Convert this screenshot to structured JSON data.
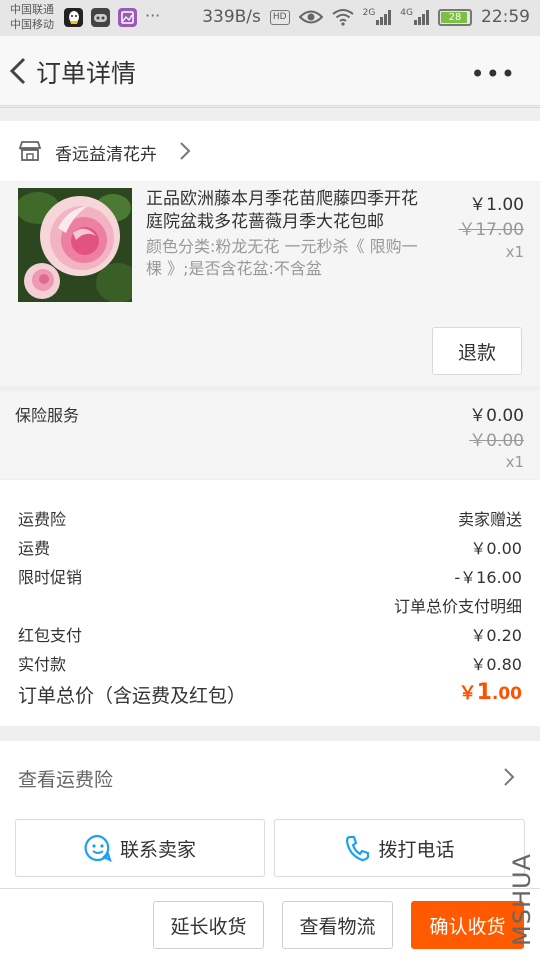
{
  "status_bar": {
    "carrier_1": "中国联通",
    "carrier_2": "中国移动",
    "more": "···",
    "speed": "339B/s",
    "hd": "HD",
    "net_1": "2G",
    "net_2": "4G",
    "battery": "28",
    "time": "22:59"
  },
  "nav": {
    "title": "订单详情",
    "more": "•••"
  },
  "shop": {
    "name": "香远益清花卉"
  },
  "product": {
    "title": "正品欧洲藤本月季花苗爬藤四季开花庭院盆栽多花蔷薇月季大花包邮",
    "sku": "颜色分类:粉龙无花 一元秒杀《 限购一棵 》;是否含花盆:不含盆",
    "price": "￥1.00",
    "original_price": "￥17.00",
    "quantity": "x1",
    "refund_label": "退款"
  },
  "insurance": {
    "label": "保险服务",
    "price": "￥0.00",
    "original_price": "￥0.00",
    "quantity": "x1"
  },
  "summary": {
    "rows": [
      {
        "label": "运费险",
        "value": "卖家赠送"
      },
      {
        "label": "运费",
        "value": "￥0.00"
      },
      {
        "label": "限时促销",
        "value": "-￥16.00"
      },
      {
        "label": "",
        "value": "订单总价支付明细"
      },
      {
        "label": "红包支付",
        "value": "￥0.20"
      },
      {
        "label": "实付款",
        "value": "￥0.80"
      }
    ],
    "total_label": "订单总价（含运费及红包）",
    "total_currency": "￥",
    "total_int": "1",
    "total_dec": ".00"
  },
  "view_insurance": {
    "label": "查看运费险"
  },
  "contact": {
    "seller_label": "联系卖家",
    "phone_label": "拨打电话"
  },
  "bottom": {
    "extend_label": "延长收货",
    "logistics_label": "查看物流",
    "confirm_label": "确认收货"
  },
  "watermark": "MSHUA",
  "colors": {
    "accent": "#ff5000",
    "confirm_bg": "#ff5a00",
    "icon_blue": "#1ea0f0"
  }
}
